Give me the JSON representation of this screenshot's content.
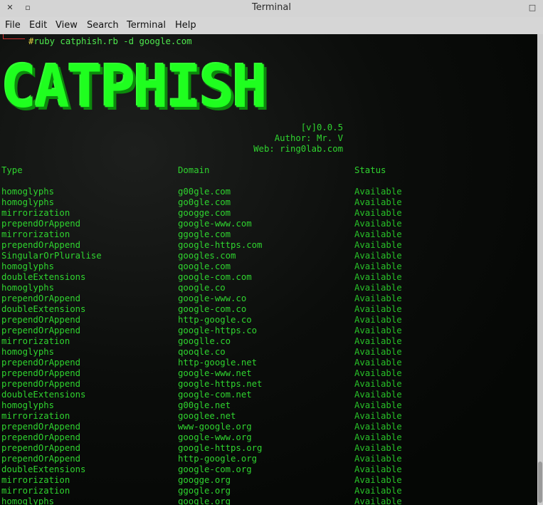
{
  "window": {
    "title": "Terminal",
    "close_glyph": "✕",
    "minimize_glyph": "▫",
    "max_glyph": "□"
  },
  "menu": [
    "File",
    "Edit",
    "View",
    "Search",
    "Terminal",
    "Help"
  ],
  "terminal": {
    "prompt_hash": "#",
    "command": "ruby catphish.rb -d google.com",
    "logo": "CATPHISH",
    "version": "[v]0.0.5",
    "author": "Author: Mr. V",
    "web": "Web: ring0lab.com",
    "headers": {
      "type": "Type",
      "domain": "Domain",
      "status": "Status"
    },
    "rows": [
      [
        "homoglyphs",
        "g00gle.com",
        "Available"
      ],
      [
        "homoglyphs",
        "go0gle.com",
        "Available"
      ],
      [
        "mirrorization",
        "googge.com",
        "Available"
      ],
      [
        "prependOrAppend",
        "google-www.com",
        "Available"
      ],
      [
        "mirrorization",
        "ggogle.com",
        "Available"
      ],
      [
        "prependOrAppend",
        "google-https.com",
        "Available"
      ],
      [
        "SingularOrPluralise",
        "googles.com",
        "Available"
      ],
      [
        "homoglyphs",
        "qoogle.com",
        "Available"
      ],
      [
        "doubleExtensions",
        "google-com.com",
        "Available"
      ],
      [
        "homoglyphs",
        "qoogle.co",
        "Available"
      ],
      [
        "prependOrAppend",
        "google-www.co",
        "Available"
      ],
      [
        "doubleExtensions",
        "google-com.co",
        "Available"
      ],
      [
        "prependOrAppend",
        "http-google.co",
        "Available"
      ],
      [
        "prependOrAppend",
        "google-https.co",
        "Available"
      ],
      [
        "mirrorization",
        "googlle.co",
        "Available"
      ],
      [
        "homoglyphs",
        "qooqle.co",
        "Available"
      ],
      [
        "prependOrAppend",
        "http-google.net",
        "Available"
      ],
      [
        "prependOrAppend",
        "google-www.net",
        "Available"
      ],
      [
        "prependOrAppend",
        "google-https.net",
        "Available"
      ],
      [
        "doubleExtensions",
        "google-com.net",
        "Available"
      ],
      [
        "homoglyphs",
        "g00gle.net",
        "Available"
      ],
      [
        "mirrorization",
        "googlee.net",
        "Available"
      ],
      [
        "prependOrAppend",
        "www-google.org",
        "Available"
      ],
      [
        "prependOrAppend",
        "google-www.org",
        "Available"
      ],
      [
        "prependOrAppend",
        "google-https.org",
        "Available"
      ],
      [
        "prependOrAppend",
        "http-google.org",
        "Available"
      ],
      [
        "doubleExtensions",
        "google-com.org",
        "Available"
      ],
      [
        "mirrorization",
        "googge.org",
        "Available"
      ],
      [
        "mirrorization",
        "ggogle.org",
        "Available"
      ],
      [
        "homoglyphs",
        "qoogle.org",
        "Available"
      ]
    ]
  },
  "colors": {
    "terminal_bg": "#050805",
    "text_green": "#2fd42f",
    "logo_green": "#1fff1f",
    "prompt_red": "#d03030",
    "hash_yellow": "#e0d040"
  }
}
